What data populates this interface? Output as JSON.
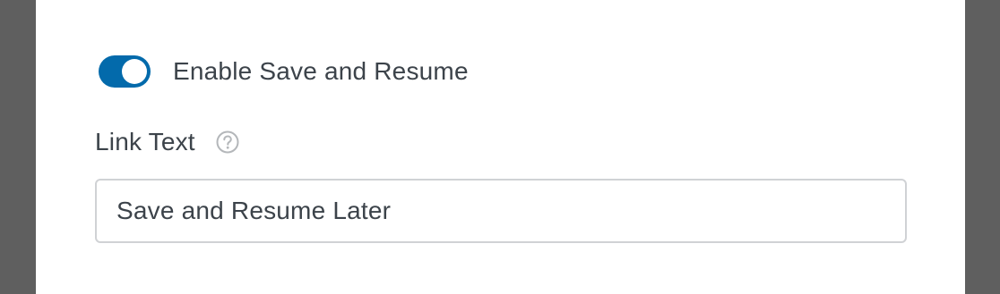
{
  "save_resume": {
    "toggle_on": true,
    "toggle_color": "#036aab",
    "label": "Enable Save and Resume"
  },
  "link_text": {
    "label": "Link Text",
    "help_icon": "question-circle-icon",
    "value": "Save and Resume Later"
  }
}
